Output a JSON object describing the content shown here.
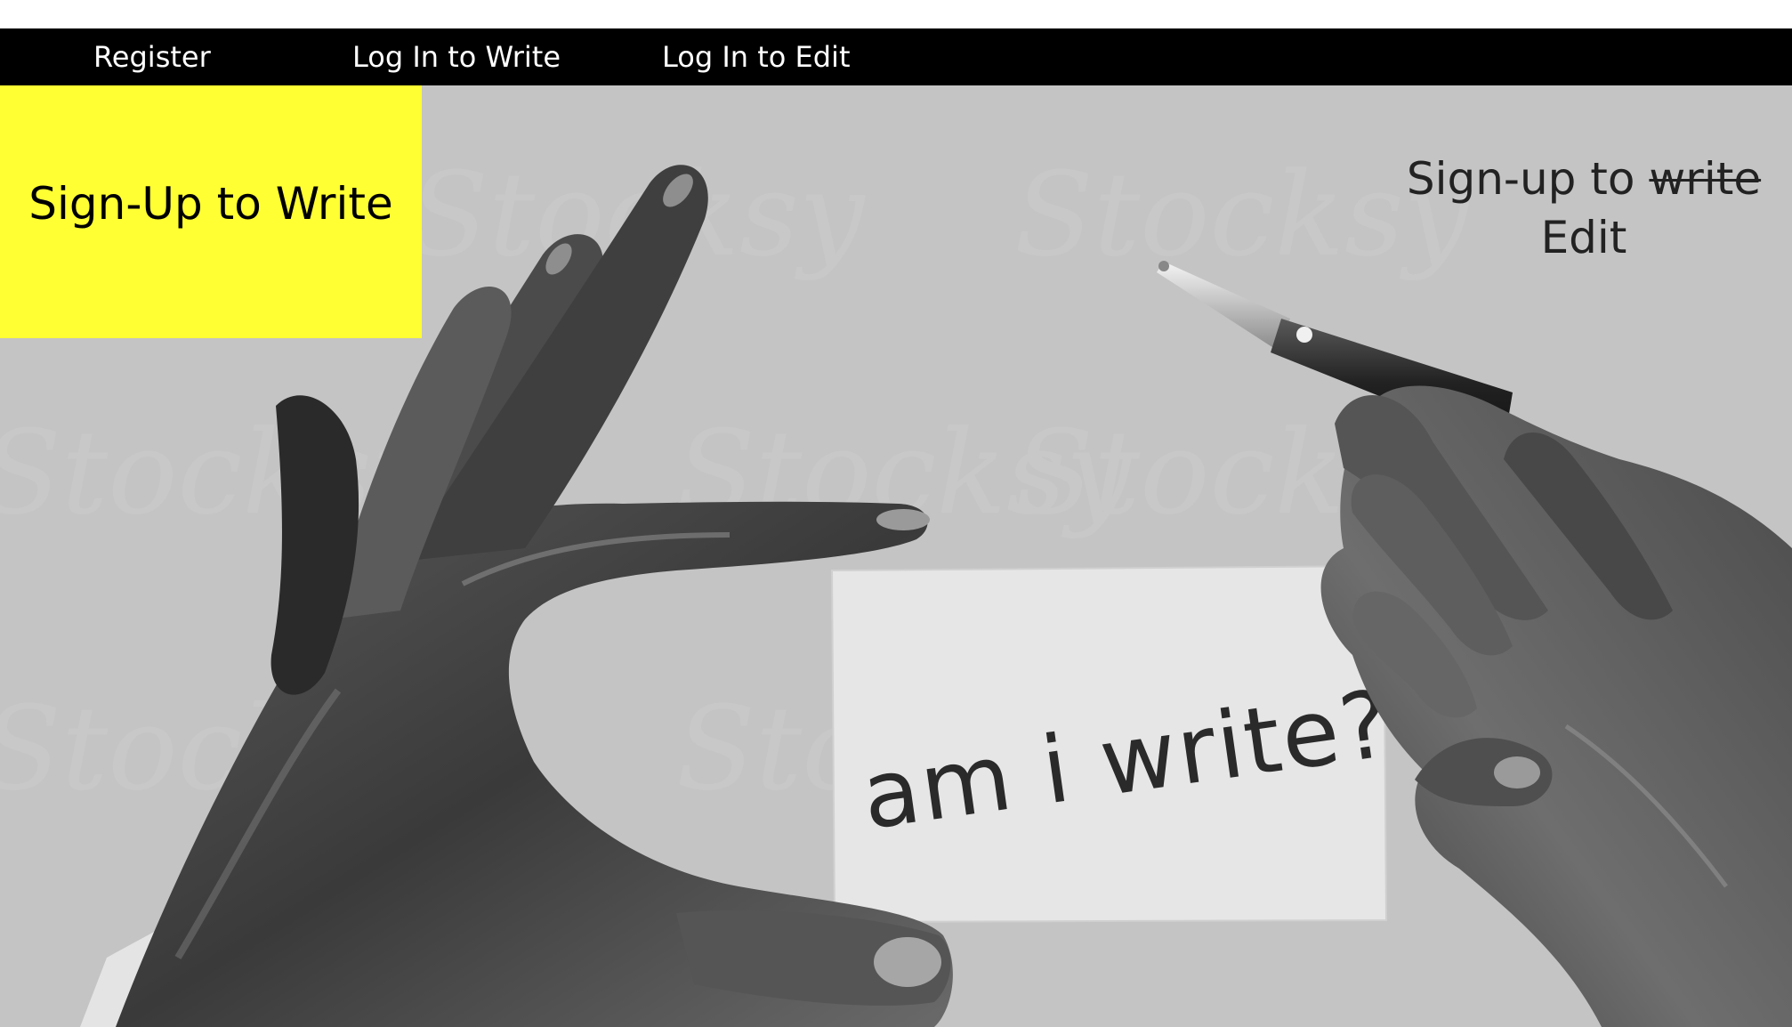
{
  "nav": {
    "register": "Register",
    "login_write": "Log In to Write",
    "login_edit": "Log In to Edit"
  },
  "hero": {
    "signup_write_label": "Sign-Up to Write",
    "signup_edit_prefix": "Sign-up to ",
    "signup_edit_struck": "write",
    "signup_edit_suffix": "Edit",
    "card_text": "am i write?",
    "watermark": "Stocksy"
  },
  "colors": {
    "navbar": "#000000",
    "accent_yellow": "#ffff33",
    "hero_background": "#c4c4c4"
  }
}
